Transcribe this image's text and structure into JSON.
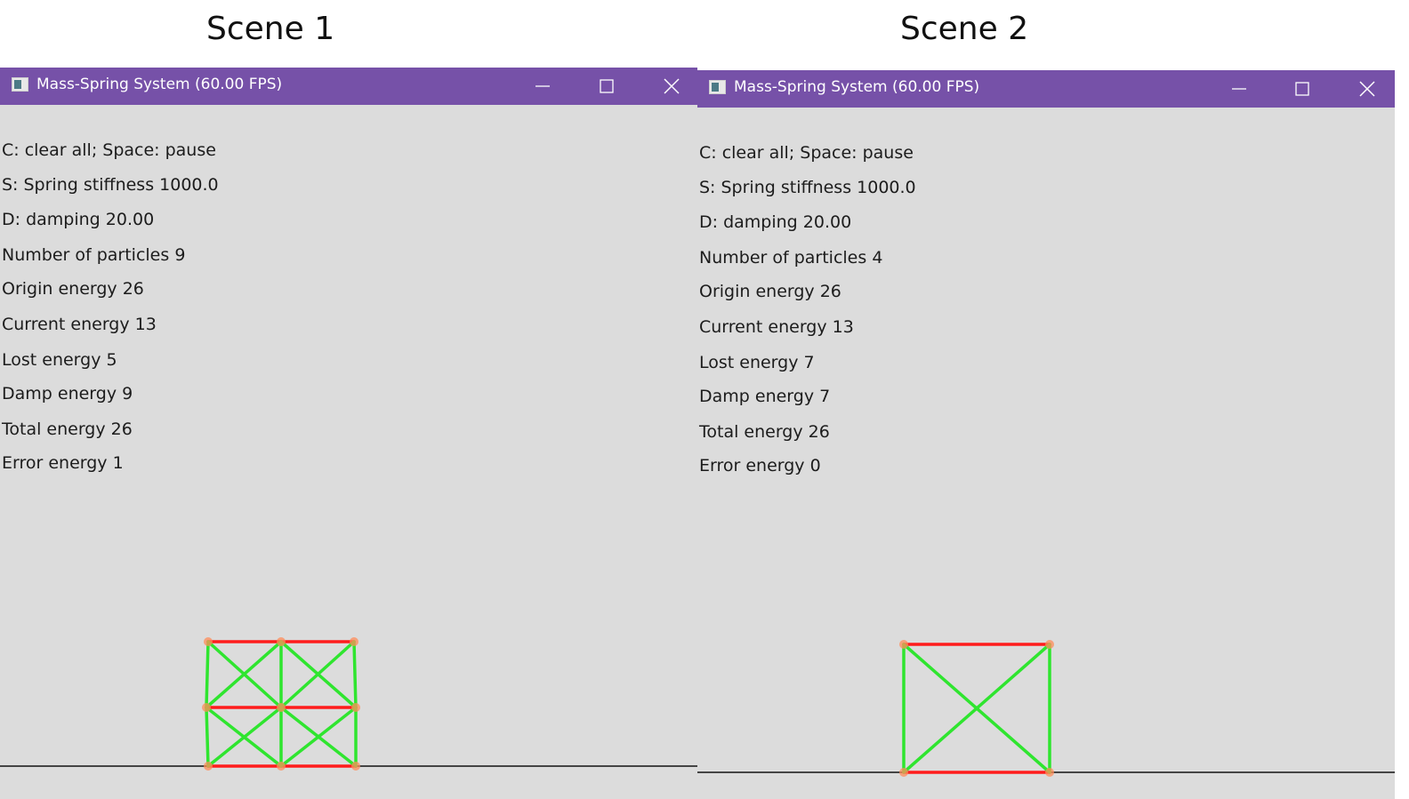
{
  "scenes": [
    {
      "title": "Scene 1",
      "window": {
        "title": "Mass-Spring System (60.00 FPS)",
        "info_lines": [
          "C: clear all; Space: pause",
          "S: Spring stiffness 1000.0",
          "D: damping 20.00",
          "Number of particles 9",
          "Origin energy 26",
          "Current energy 13",
          "Lost energy 5",
          "Damp energy 9",
          "Total energy 26",
          "Error energy 1"
        ]
      },
      "simulation": {
        "type": "grid-2x2",
        "particle_count": 9
      }
    },
    {
      "title": "Scene 2",
      "window": {
        "title": "Mass-Spring System (60.00 FPS)",
        "info_lines": [
          "C: clear all; Space: pause",
          "S: Spring stiffness 1000.0",
          "D: damping 20.00",
          "Number of particles 4",
          "Origin energy 26",
          "Current energy 13",
          "Lost energy 7",
          "Damp energy 7",
          "Total energy 26",
          "Error energy 0"
        ]
      },
      "simulation": {
        "type": "single-cell",
        "particle_count": 4
      }
    }
  ],
  "colors": {
    "titlebar": "#7651a8",
    "canvas_background": "#dcdcdc",
    "stretched_spring": "#2fe52f",
    "compressed_spring": "#ff1c1c",
    "particle": "#ff8c5a",
    "ground": "#444444"
  },
  "icons": {
    "minimize": "minimize-icon",
    "maximize": "maximize-icon",
    "close": "close-icon",
    "app": "app-window-icon"
  }
}
